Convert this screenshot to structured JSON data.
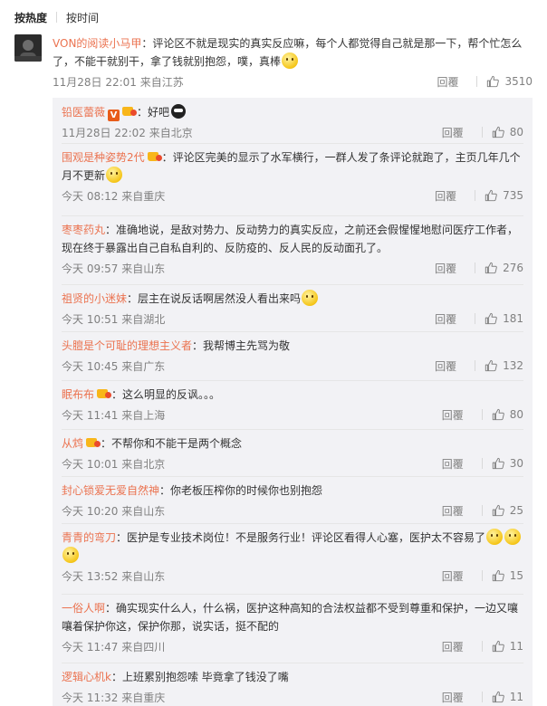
{
  "sort": {
    "hot": "按热度",
    "time": "按时间"
  },
  "main": {
    "user": "VON的阅读小马甲",
    "text": "：评论区不就是现实的真实反应嘛，每个人都觉得自己就是那一下，帮个忙怎么了，不能干就别干，拿了钱就别抱怨，噗，真棒",
    "time": "11月28日 22:01 来自江苏",
    "reply": "回覆",
    "likes": "3510"
  },
  "replies": [
    {
      "user": "铅医蕾薇",
      "text": "：好吧",
      "time": "11月28日 22:02 来自北京",
      "reply": "回覆",
      "likes": "80"
    },
    {
      "user": "围观是种姿势2代",
      "text": "：评论区完美的显示了水军横行，一群人发了条评论就跑了，主页几年几个月不更新",
      "time": "今天 08:12 来自重庆",
      "reply": "回覆",
      "likes": "735"
    },
    {
      "user": "枣枣药丸",
      "text": "：准确地说，是敌对势力、反动势力的真实反应，之前还会假惺惺地慰问医疗工作者，现在终于暴露出自己自私自利的、反防疫的、反人民的反动面孔了。",
      "time": "今天 09:57 来自山东",
      "reply": "回覆",
      "likes": "276"
    },
    {
      "user": "祖贤的小迷妹",
      "text": "：层主在说反话啊居然没人看出来吗",
      "time": "今天 10:51 来自湖北",
      "reply": "回覆",
      "likes": "181"
    },
    {
      "user": "头膻是个可耻的理想主义者",
      "text": "：我帮博主先骂为敬",
      "time": "今天 10:45 来自广东",
      "reply": "回覆",
      "likes": "132"
    },
    {
      "user": "眠布布",
      "text": "：这么明显的反讽。。。",
      "time": "今天 11:41 来自上海",
      "reply": "回覆",
      "likes": "80"
    },
    {
      "user": "从鸩",
      "text": "：不帮你和不能干是两个概念",
      "time": "今天 10:01 来自北京",
      "reply": "回覆",
      "likes": "30"
    },
    {
      "user": "封心锁爱无爱自然神",
      "text": "：你老板压榨你的时候你也别抱怨",
      "time": "今天 10:20 来自山东",
      "reply": "回覆",
      "likes": "25"
    },
    {
      "user": "青青的弯刀",
      "text": "：医护是专业技术岗位！不是服务行业！评论区看得人心塞，医护太不容易了",
      "time": "今天 13:52 来自山东",
      "reply": "回覆",
      "likes": "15"
    },
    {
      "user": "一俗人啊",
      "text": "：确实现实什么人，什么祸，医护这种高知的合法权益都不受到尊重和保护，一边又嚷嚷着保护你这，保护你那，说实话，挺不配的",
      "time": "今天 11:47 来自四川",
      "reply": "回覆",
      "likes": "11"
    },
    {
      "user": "逻辑心机k",
      "text": "：上班累别抱怨嗦 毕竟拿了钱没了嘴",
      "time": "今天 11:32 来自重庆",
      "reply": "回覆",
      "likes": "11"
    }
  ],
  "colors": {
    "accent": "#eb7350",
    "meta": "#808080",
    "sub_bg": "#f2f2f5"
  }
}
